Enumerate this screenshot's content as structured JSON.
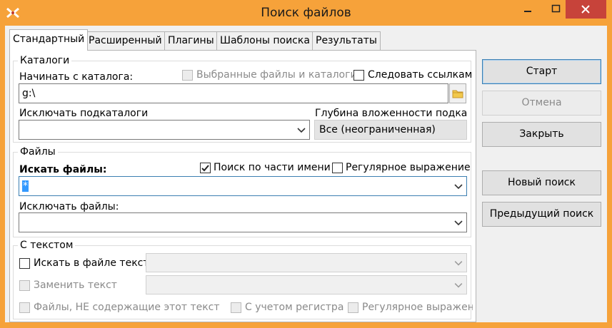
{
  "window": {
    "title": "Поиск файлов",
    "title_bar_color": "#f6a23a",
    "close_button_color": "#c7433a"
  },
  "tabs": [
    {
      "label": "Стандартный",
      "active": true
    },
    {
      "label": "Расширенный",
      "active": false
    },
    {
      "label": "Плагины",
      "active": false
    },
    {
      "label": "Шаблоны поиска",
      "active": false
    },
    {
      "label": "Результаты",
      "active": false
    }
  ],
  "catalogs": {
    "group_label": "Каталоги",
    "start_dir_label": "Начинать с каталога:",
    "start_dir_value": "g:\\",
    "selected_files_label": "Выбранные файлы и каталоги",
    "follow_links_label": "Следовать ссылкам",
    "exclude_subdirs_label": "Исключать подкаталоги",
    "exclude_subdirs_value": "",
    "depth_label": "Глубина вложенности подката.",
    "depth_value": "Все (неограниченная)"
  },
  "files": {
    "group_label": "Файлы",
    "search_files_label": "Искать файлы:",
    "search_files_value": "*",
    "partial_name_label": "Поиск по части имени",
    "partial_name_checked": true,
    "regex_label": "Регулярное выражение",
    "exclude_files_label": "Исключать файлы:",
    "exclude_files_value": ""
  },
  "text": {
    "group_label": "С текстом",
    "find_text_label": "Искать в файле текст",
    "replace_text_label": "Заменить текст",
    "not_containing_label": "Файлы, НЕ содержащие этот текст",
    "case_label": "С учетом регистра",
    "regex_label": "Регулярное выражени"
  },
  "buttons": {
    "start": "Старт",
    "cancel": "Отмена",
    "close": "Закрыть",
    "new_search": "Новый поиск",
    "prev_search": "Предыдущий поиск"
  },
  "icons": {
    "app": "multi-commander-icon",
    "browse": "folder-icon",
    "dropdown": "chevron-down-icon",
    "check": "checkmark-icon"
  },
  "colors": {
    "selection": "#3399ff",
    "default_button_border": "#3c7fb1"
  }
}
